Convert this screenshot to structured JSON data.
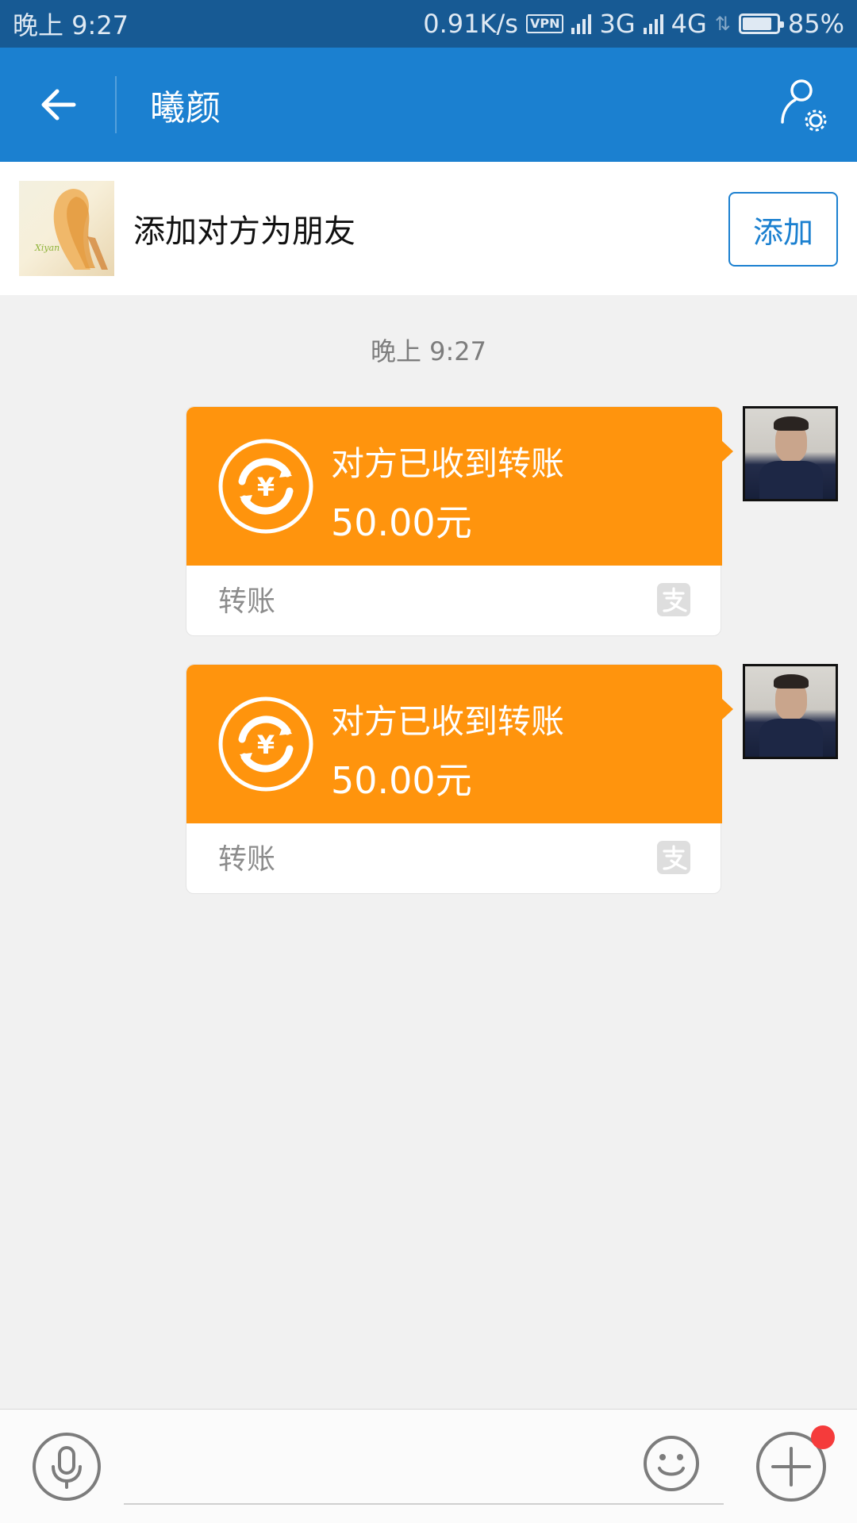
{
  "status_bar": {
    "time": "晚上 9:27",
    "network_speed": "0.91K/s",
    "vpn": "VPN",
    "net1": "3G",
    "net2": "4G",
    "battery_level": 0.85,
    "battery": "85%"
  },
  "header": {
    "title": "曦颜",
    "back_icon": "arrow-left-icon",
    "profile_icon": "profile-settings-icon"
  },
  "banner": {
    "avatar_caption": "Xiyan",
    "text": "添加对方为朋友",
    "add_label": "添加"
  },
  "chat": {
    "timestamp": "晚上 9:27",
    "messages": [
      {
        "status": "对方已收到转账",
        "amount": "50.00元",
        "label": "转账",
        "brand_icon": "alipay-icon"
      },
      {
        "status": "对方已收到转账",
        "amount": "50.00元",
        "label": "转账",
        "brand_icon": "alipay-icon"
      }
    ]
  },
  "input_bar": {
    "input_value": "",
    "voice_icon": "microphone-icon",
    "emoji_icon": "smiley-icon",
    "plus_icon": "plus-icon",
    "has_notification": true
  },
  "colors": {
    "status_bar": "#175a94",
    "header": "#1b80d0",
    "transfer": "#ff940d",
    "background": "#f1f1f1",
    "notification": "#f53b3b"
  }
}
